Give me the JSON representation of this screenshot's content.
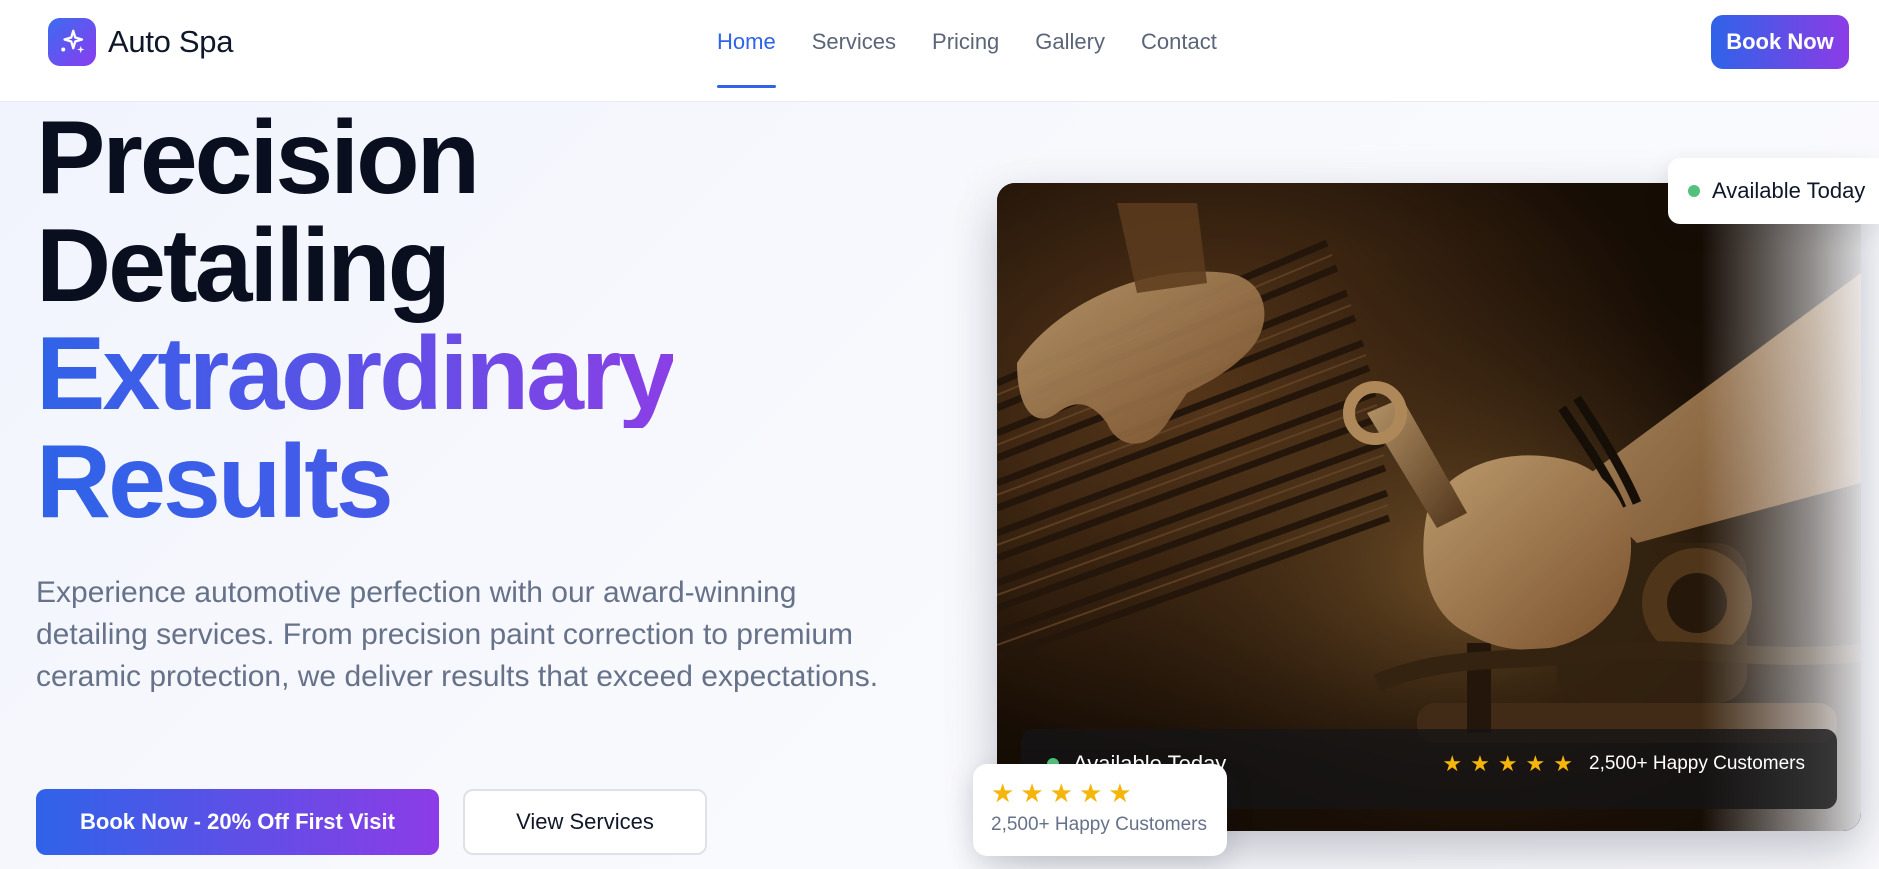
{
  "brand": {
    "name": "Auto Spa",
    "icon": "sparkle-icon",
    "gradient": [
      "#3b6cf0",
      "#8b3cf0"
    ]
  },
  "nav": {
    "links": [
      {
        "label": "Home",
        "active": true
      },
      {
        "label": "Services",
        "active": false
      },
      {
        "label": "Pricing",
        "active": false
      },
      {
        "label": "Gallery",
        "active": false
      },
      {
        "label": "Contact",
        "active": false
      }
    ],
    "cta_label": "Book Now"
  },
  "hero": {
    "headline": {
      "line1": "Precision",
      "line2": "Detailing",
      "line3": "Extraordinary",
      "line4": "Results"
    },
    "description": "Experience automotive perfection with our award-winning detailing services. From precision paint correction to premium ceramic protection, we deliver results that exceed expectations.",
    "primary_button": "Book Now - 20% Off First Visit",
    "secondary_button": "View Services"
  },
  "image_card": {
    "alt_subject": "mechanic-hands-with-wrench-in-engine-bay",
    "overlay": {
      "availability": "Available Today",
      "rating_stars": 5,
      "rating_text": "2,500+ Happy Customers"
    }
  },
  "badges": {
    "availability": "Available Today",
    "rating_stars": 5,
    "rating_text": "2,500+ Happy Customers"
  },
  "colors": {
    "accent": "#2f63e8",
    "accent_end": "#8c3ce6",
    "status_green": "#52c27a",
    "star": "#f5b50a"
  }
}
